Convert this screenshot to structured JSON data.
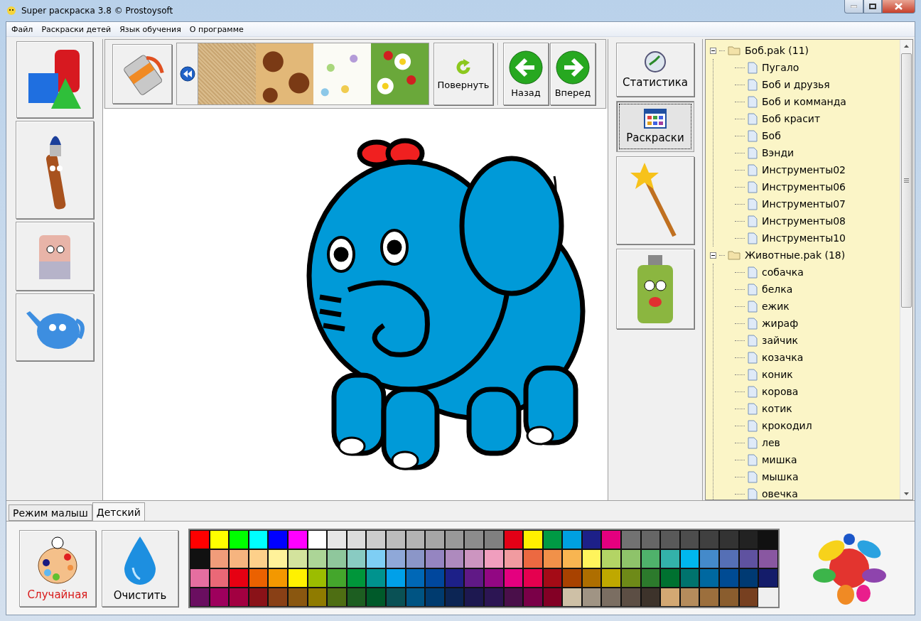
{
  "window": {
    "title": "Super раскраска 3.8 © Prostoysoft"
  },
  "menu": [
    "Файл",
    "Раскраски детей",
    "Язык обучения",
    "О программе"
  ],
  "toolbar": {
    "buttons": [
      {
        "kind": "rotate",
        "label": "Повернуть"
      },
      {
        "kind": "back",
        "label": "Назад"
      },
      {
        "kind": "forward",
        "label": "Вперед"
      }
    ]
  },
  "side_buttons": [
    {
      "kind": "stats",
      "label": "Статистика",
      "selected": false
    },
    {
      "kind": "pages",
      "label": "Раскраски",
      "selected": true
    },
    {
      "kind": "wand",
      "selected": false
    },
    {
      "kind": "spray",
      "selected": false
    }
  ],
  "tree": [
    {
      "label": "Боб.pak (11)",
      "expanded": true,
      "children": [
        {
          "label": "Пугало"
        },
        {
          "label": "Боб и друзья"
        },
        {
          "label": "Боб и комманда"
        },
        {
          "label": "Боб красит"
        },
        {
          "label": "Боб"
        },
        {
          "label": "Вэнди"
        },
        {
          "label": "Инструменты02"
        },
        {
          "label": "Инструменты06"
        },
        {
          "label": "Инструменты07"
        },
        {
          "label": "Инструменты08"
        },
        {
          "label": "Инструменты10"
        }
      ]
    },
    {
      "label": "Животные.pak (18)",
      "expanded": true,
      "children": [
        {
          "label": "собачка"
        },
        {
          "label": "белка"
        },
        {
          "label": "ежик"
        },
        {
          "label": "жираф"
        },
        {
          "label": "зайчик"
        },
        {
          "label": "козачка"
        },
        {
          "label": "коник"
        },
        {
          "label": "корова"
        },
        {
          "label": "котик"
        },
        {
          "label": "крокодил"
        },
        {
          "label": "лев"
        },
        {
          "label": "мишка"
        },
        {
          "label": "мышка"
        },
        {
          "label": "овечка"
        }
      ]
    }
  ],
  "tabs": [
    {
      "label": "Режим малыш",
      "selected": false
    },
    {
      "label": "Детский",
      "selected": true
    }
  ],
  "actions": [
    {
      "kind": "random",
      "label": "Случайная"
    },
    {
      "kind": "clear",
      "label": "Очистить"
    }
  ],
  "palette": [
    [
      {
        "color": "#ff0000"
      },
      {
        "color": "#ffff00"
      },
      {
        "color": "#00ff00"
      },
      {
        "color": "#00ffff"
      },
      {
        "color": "#0000ff"
      },
      {
        "color": "#ff00ff"
      },
      {
        "color": "#ffffff"
      },
      {
        "color": "#e6e6e6"
      },
      {
        "color": "#dcdcdc"
      },
      {
        "color": "#cccccc"
      },
      {
        "color": "#bcbcbc"
      },
      {
        "color": "#b3b3b3"
      },
      {
        "color": "#a6a6a6"
      },
      {
        "color": "#999999"
      },
      {
        "color": "#8c8c8c"
      },
      {
        "color": "#808080"
      },
      {
        "color": "#e30016"
      },
      {
        "color": "#fff100"
      },
      {
        "color": "#009a44"
      },
      {
        "color": "#00a0e0"
      },
      {
        "color": "#1d2088"
      },
      {
        "color": "#e4007f"
      },
      {
        "color": "#727272"
      },
      {
        "color": "#666666"
      },
      {
        "color": "#595959"
      },
      {
        "color": "#4d4d4d"
      },
      {
        "color": "#404040"
      },
      {
        "color": "#333333"
      },
      {
        "color": "#222222"
      },
      {
        "color": "#111111"
      }
    ],
    [
      {
        "color": "#111111"
      },
      {
        "color": "#f19c7a"
      },
      {
        "color": "#f6b47f"
      },
      {
        "color": "#fdd08a"
      },
      {
        "color": "#fff29a"
      },
      {
        "color": "#d3e39d"
      },
      {
        "color": "#acd597"
      },
      {
        "color": "#8fc79c"
      },
      {
        "color": "#89cbc2"
      },
      {
        "color": "#7ecef4"
      },
      {
        "color": "#8fa8d8"
      },
      {
        "color": "#8b96c8"
      },
      {
        "color": "#9585c1"
      },
      {
        "color": "#ae8abe"
      },
      {
        "color": "#cc95c0"
      },
      {
        "color": "#f09ebe"
      },
      {
        "color": "#f19ba0"
      },
      {
        "color": "#ec6941"
      },
      {
        "color": "#f19149"
      },
      {
        "color": "#f8b551"
      },
      {
        "color": "#fff45c"
      },
      {
        "color": "#b3d465"
      },
      {
        "color": "#8ec36a"
      },
      {
        "color": "#4fb26b"
      },
      {
        "color": "#33b2aa"
      },
      {
        "color": "#00b7ee"
      },
      {
        "color": "#448aca"
      },
      {
        "color": "#556fb5"
      },
      {
        "color": "#5f52a0"
      },
      {
        "color": "#8957a1"
      }
    ],
    [
      {
        "color": "#e56ea0"
      },
      {
        "color": "#ea6877"
      },
      {
        "color": "#e60012"
      },
      {
        "color": "#eb6100"
      },
      {
        "color": "#f39800"
      },
      {
        "color": "#fff100"
      },
      {
        "color": "#9bbd00"
      },
      {
        "color": "#44a62c"
      },
      {
        "color": "#00963a"
      },
      {
        "color": "#00938e"
      },
      {
        "color": "#00a0e9"
      },
      {
        "color": "#0068b7"
      },
      {
        "color": "#00479d"
      },
      {
        "color": "#1d2088"
      },
      {
        "color": "#601986"
      },
      {
        "color": "#920783"
      },
      {
        "color": "#e4007f"
      },
      {
        "color": "#e5004f"
      },
      {
        "color": "#a40b16"
      },
      {
        "color": "#a84200"
      },
      {
        "color": "#ae6e00"
      },
      {
        "color": "#bfa800"
      },
      {
        "color": "#6e8a18"
      },
      {
        "color": "#2c7a2c"
      },
      {
        "color": "#007130"
      },
      {
        "color": "#00736d"
      },
      {
        "color": "#0068a0"
      },
      {
        "color": "#004b93"
      },
      {
        "color": "#003a73"
      },
      {
        "color": "#141c6a"
      }
    ],
    [
      {
        "color": "#6a0e60"
      },
      {
        "color": "#9e005d"
      },
      {
        "color": "#a20041"
      },
      {
        "color": "#8a1218"
      },
      {
        "color": "#894016"
      },
      {
        "color": "#8a5710"
      },
      {
        "color": "#8f7b00"
      },
      {
        "color": "#4e6e13"
      },
      {
        "color": "#1d5e21"
      },
      {
        "color": "#005a2a"
      },
      {
        "color": "#0a5155"
      },
      {
        "color": "#005483"
      },
      {
        "color": "#003b6f"
      },
      {
        "color": "#0c2554"
      },
      {
        "color": "#1d1850"
      },
      {
        "color": "#2c1553"
      },
      {
        "color": "#4a0f4a"
      },
      {
        "color": "#7a0048"
      },
      {
        "color": "#830025"
      },
      {
        "color": "#cec0a6"
      },
      {
        "color": "#a09484"
      },
      {
        "color": "#7b6e62"
      },
      {
        "color": "#5c4e44"
      },
      {
        "color": "#3d332b"
      },
      {
        "color": "#d3a873"
      },
      {
        "color": "#b58c5c"
      },
      {
        "color": "#9c6f3d"
      },
      {
        "color": "#8a5d2e"
      },
      {
        "color": "#774020"
      }
    ]
  ]
}
